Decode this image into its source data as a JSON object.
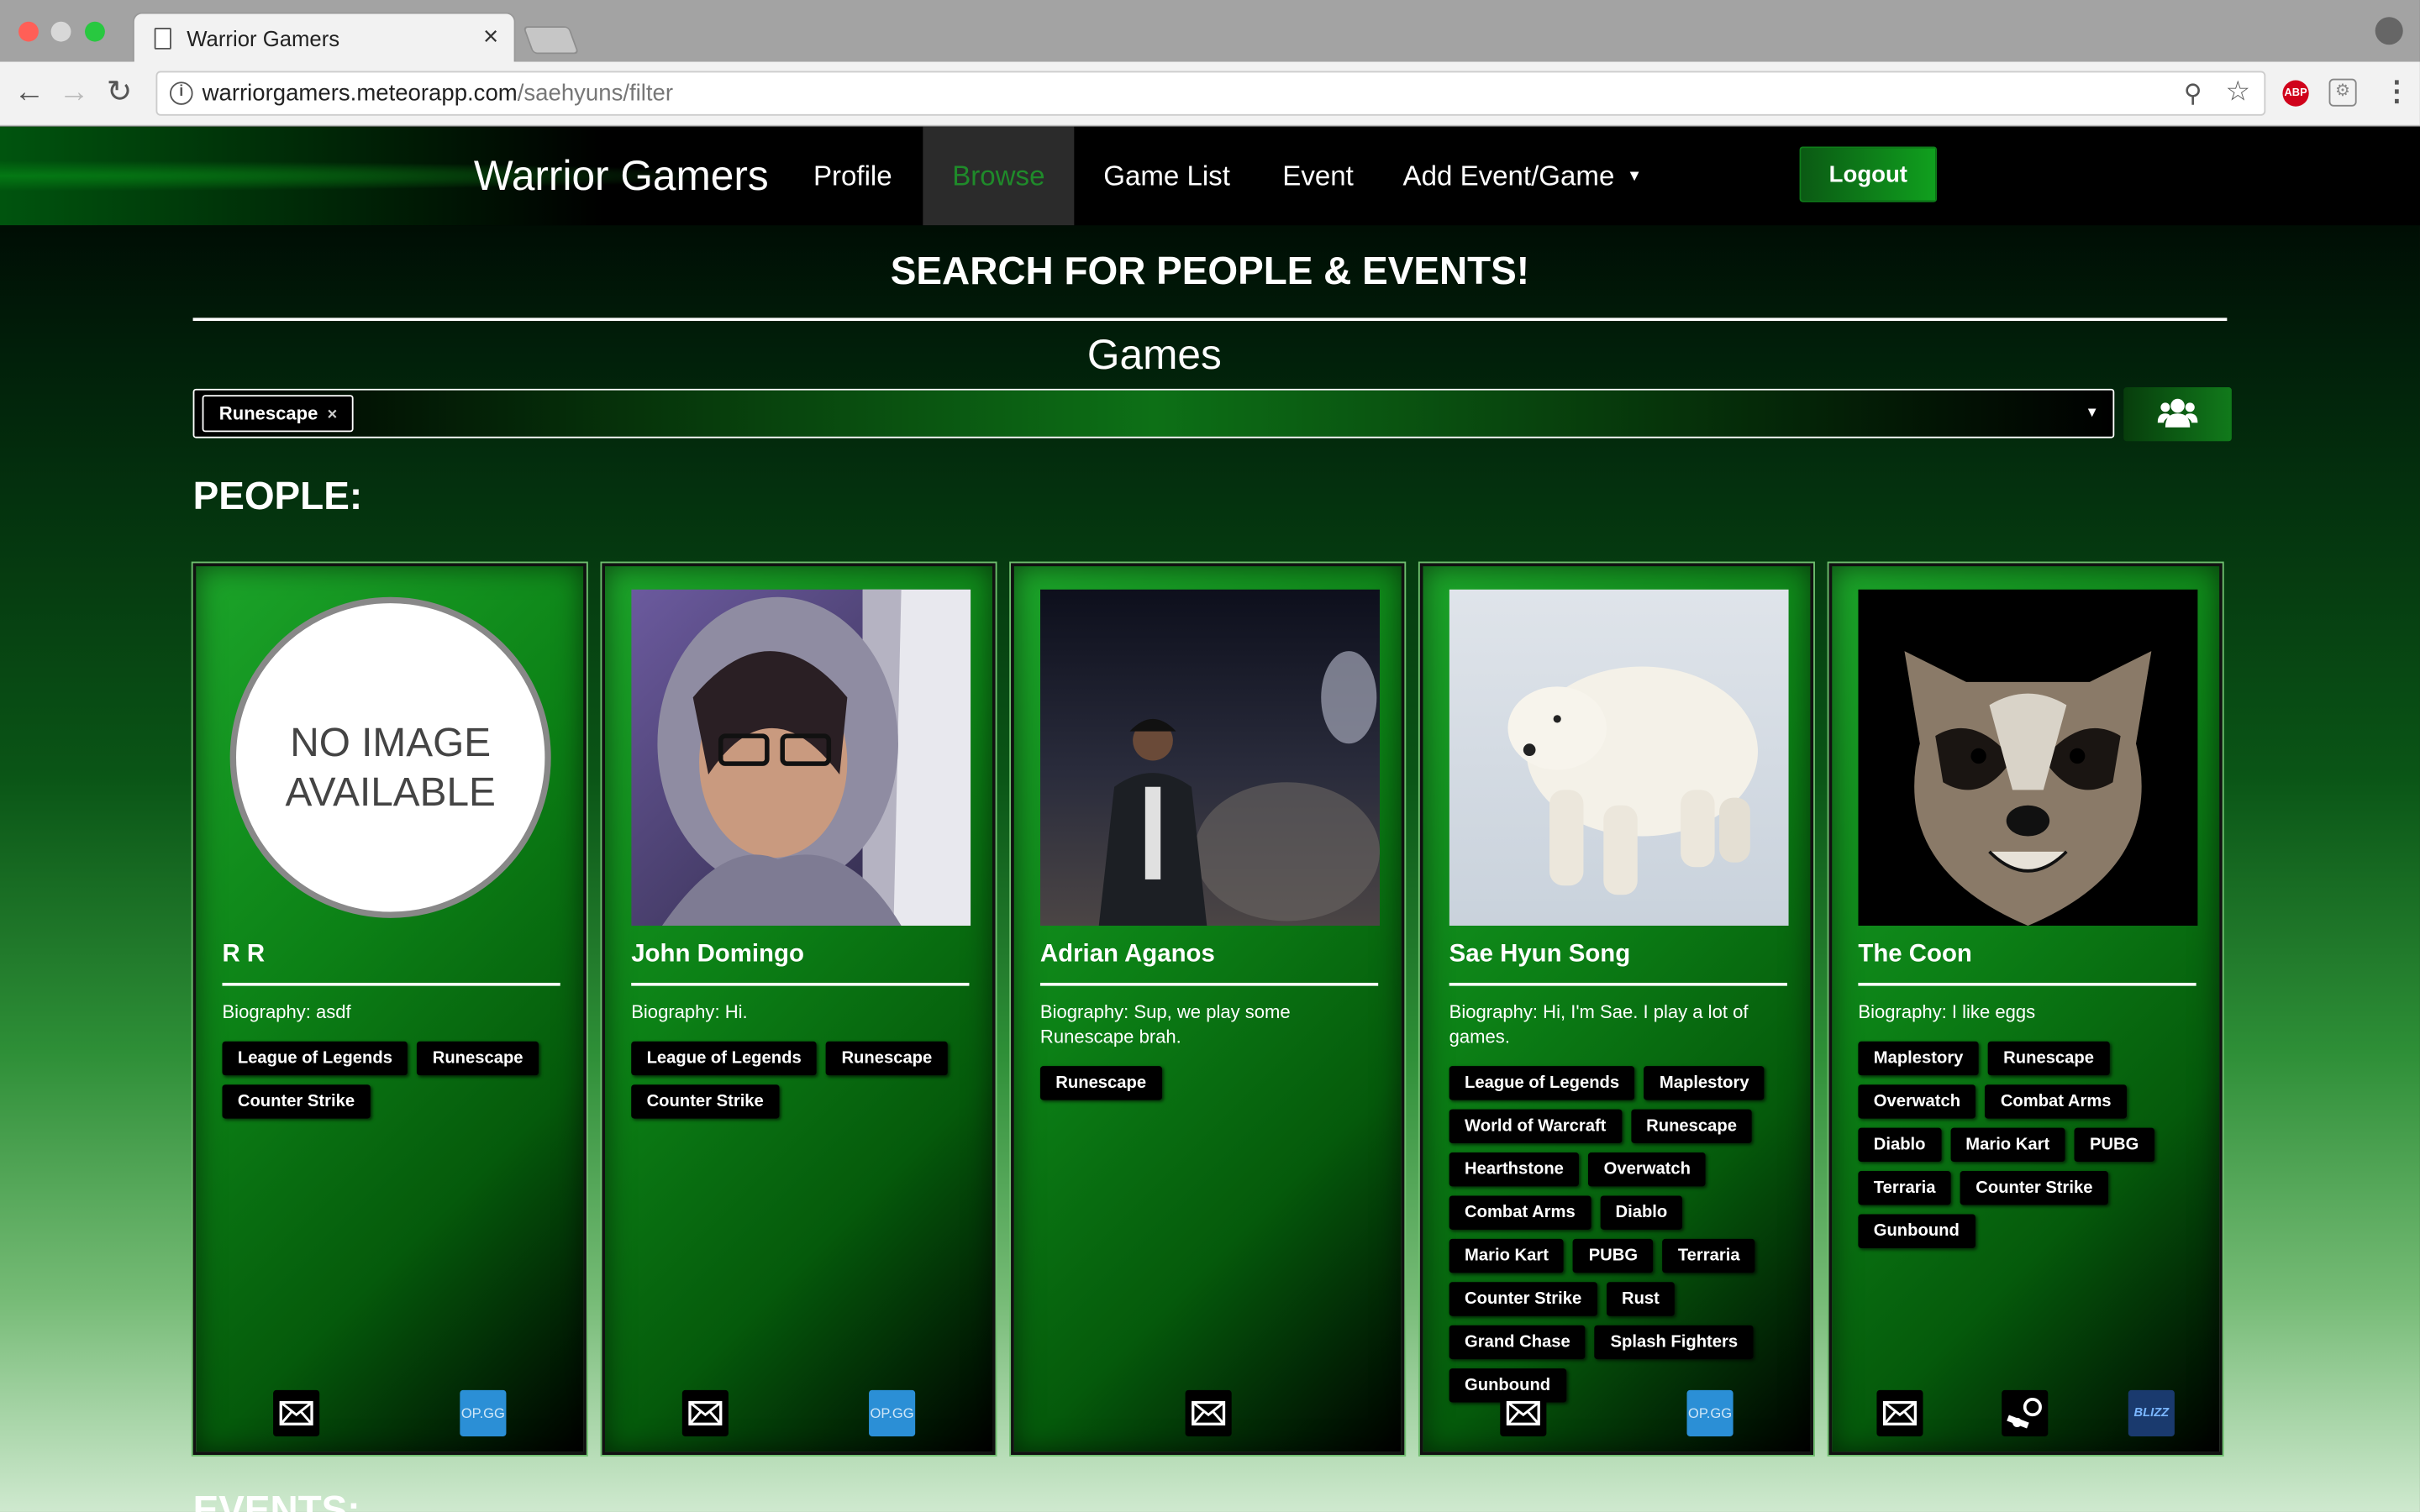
{
  "browser": {
    "tab_title": "Warrior Gamers",
    "tab_close": "×",
    "url_host": "warriorgamers.meteorapp.com",
    "url_path": "/saehyuns/filter",
    "abp_label": "ABP"
  },
  "nav": {
    "brand": "Warrior Gamers",
    "items": [
      "Profile",
      "Browse",
      "Game List",
      "Event",
      "Add Event/Game"
    ],
    "logout": "Logout"
  },
  "search": {
    "title": "SEARCH FOR PEOPLE & EVENTS!",
    "games_heading": "Games",
    "selected_chip": "Runescape",
    "chip_remove": "×"
  },
  "people_heading": "PEOPLE:",
  "events_heading": "EVENTS:",
  "no_image_text": "NO IMAGE AVAILABLE",
  "opgg_label": "OP.GG",
  "people": [
    {
      "name": "R R",
      "bio": "Biography: asdf",
      "games": [
        "League of Legends",
        "Runescape",
        "Counter Strike"
      ]
    },
    {
      "name": "John Domingo",
      "bio": "Biography: Hi.",
      "games": [
        "League of Legends",
        "Runescape",
        "Counter Strike"
      ]
    },
    {
      "name": "Adrian Aganos",
      "bio": "Biography: Sup, we play some Runescape brah.",
      "games": [
        "Runescape"
      ]
    },
    {
      "name": "Sae Hyun Song",
      "bio": "Biography: Hi, I'm Sae. I play a lot of games.",
      "games": [
        "League of Legends",
        "Maplestory",
        "World of Warcraft",
        "Runescape",
        "Hearthstone",
        "Overwatch",
        "Combat Arms",
        "Diablo",
        "Mario Kart",
        "PUBG",
        "Terraria",
        "Counter Strike",
        "Rust",
        "Grand Chase",
        "Splash Fighters",
        "Gunbound"
      ]
    },
    {
      "name": "The Coon",
      "bio": "Biography: I like eggs",
      "games": [
        "Maplestory",
        "Runescape",
        "Overwatch",
        "Combat Arms",
        "Diablo",
        "Mario Kart",
        "PUBG",
        "Terraria",
        "Counter Strike",
        "Gunbound"
      ]
    }
  ],
  "colors": {
    "accent": "#0c8116",
    "browse_active": "#1f8a2a",
    "opgg": "#2b8fd6"
  }
}
